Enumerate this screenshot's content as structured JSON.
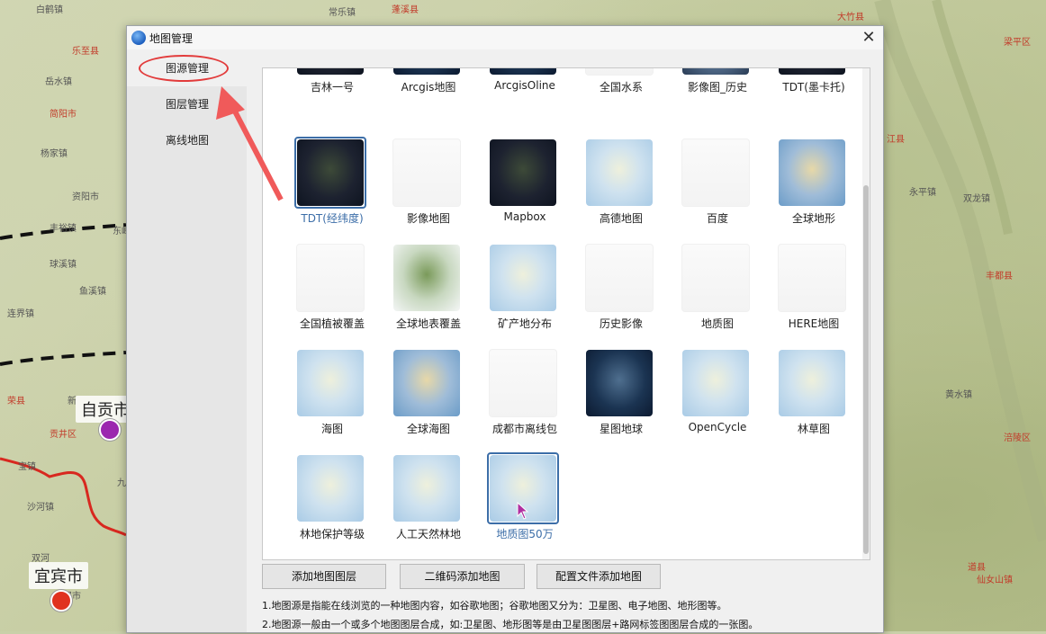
{
  "window": {
    "title": "地图管理"
  },
  "sidebar": {
    "items": [
      {
        "label": "图源管理",
        "active": true
      },
      {
        "label": "图层管理",
        "active": false
      },
      {
        "label": "离线地图",
        "active": false
      }
    ]
  },
  "tiles": [
    {
      "label": "吉林一号",
      "style": "dark"
    },
    {
      "label": "Arcgis地图",
      "style": "darkblue"
    },
    {
      "label": "ArcgisOline",
      "style": "darkblue"
    },
    {
      "label": "全国水系",
      "style": "white"
    },
    {
      "label": "影像图_历史",
      "style": "blue"
    },
    {
      "label": "TDT(墨卡托)",
      "style": "dark"
    },
    {
      "label": "TDT(经纬度)",
      "style": "dark",
      "selected": true
    },
    {
      "label": "影像地图",
      "style": "white"
    },
    {
      "label": "Mapbox",
      "style": "dark"
    },
    {
      "label": "高德地图",
      "style": "light"
    },
    {
      "label": "百度",
      "style": "white"
    },
    {
      "label": "全球地形",
      "style": "terrain"
    },
    {
      "label": "全国植被覆盖",
      "style": "white"
    },
    {
      "label": "全球地表覆盖",
      "style": "green"
    },
    {
      "label": "矿产地分布",
      "style": "light"
    },
    {
      "label": "历史影像",
      "style": "white"
    },
    {
      "label": "地质图",
      "style": "white"
    },
    {
      "label": "HERE地图",
      "style": "white"
    },
    {
      "label": "海图",
      "style": "light"
    },
    {
      "label": "全球海图",
      "style": "terrain"
    },
    {
      "label": "成都市离线包",
      "style": "white"
    },
    {
      "label": "星图地球",
      "style": "darkblue"
    },
    {
      "label": "OpenCycle",
      "style": "light"
    },
    {
      "label": "林草图",
      "style": "light"
    },
    {
      "label": "林地保护等级",
      "style": "light"
    },
    {
      "label": "人工天然林地",
      "style": "light"
    },
    {
      "label": "地质图50万",
      "style": "light",
      "selected": true
    }
  ],
  "buttons": {
    "add_layer": "添加地图图层",
    "qr_add": "二维码添加地图",
    "config_add": "配置文件添加地图"
  },
  "notes": {
    "line1": "1.地图源是指能在线浏览的一种地图内容，如谷歌地图；谷歌地图又分为：卫星图、电子地图、地形图等。",
    "line2": "2.地图源一般由一个或多个地图图层合成，如:卫星图、地形图等是由卫星图图层+路网标签图图层合成的一张图。"
  },
  "background_map": {
    "cities": [
      {
        "name": "自贡市",
        "sub": "贡井区"
      },
      {
        "name": "宜宾市",
        "sub": "翠屏市"
      }
    ],
    "labels_left": [
      "白鹤镇",
      "乐至县",
      "岳水镇",
      "简阳市",
      "杨家镇",
      "资阳市",
      "丰裕镇",
      "东峰",
      "球溪镇",
      "鱼溪镇",
      "连界镇",
      "荣县",
      "新",
      "宝镇",
      "九",
      "双河",
      "沙河镇"
    ],
    "labels_right": [
      "蓬溪县",
      "常乐镇",
      "大竹县",
      "梁平区",
      "江县",
      "永平镇",
      "双龙镇",
      "丰都县",
      "黄水镇",
      "涪陵区",
      "道县",
      "仙女山镇"
    ]
  }
}
